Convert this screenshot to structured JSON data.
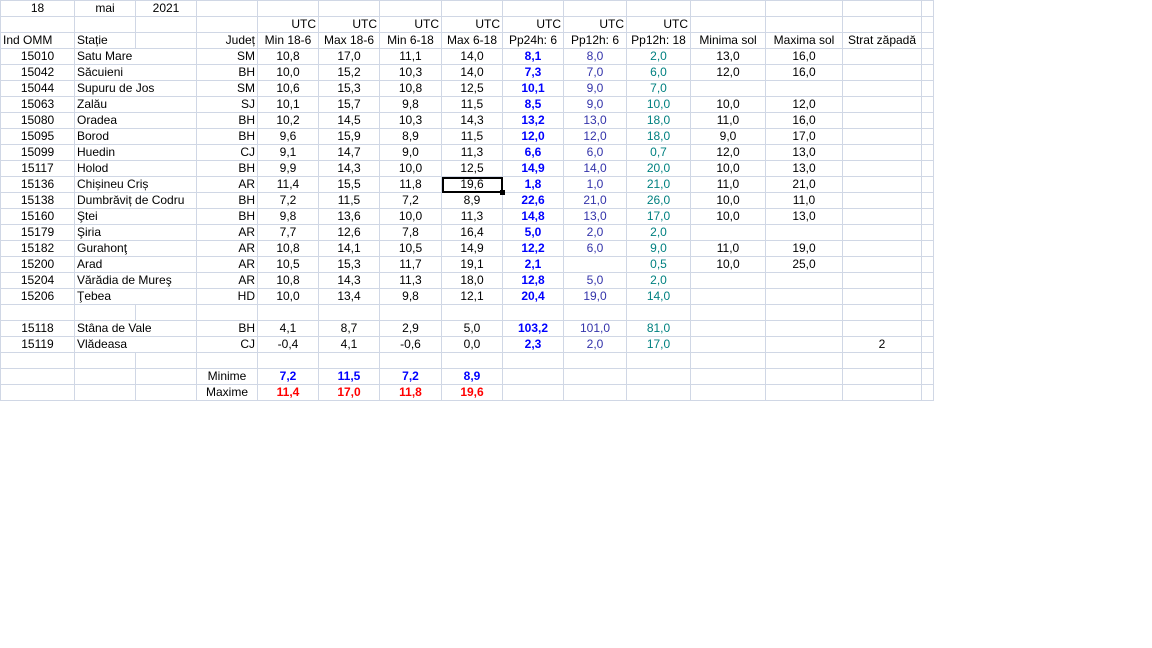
{
  "header": {
    "day": "18",
    "month": "mai",
    "year": "2021"
  },
  "utc_label": "UTC",
  "columns": [
    "Ind OMM",
    "Stație",
    "",
    "Județ",
    "Min 18-6",
    "Max 18-6",
    "Min 6-18",
    "Max 6-18",
    "Pp24h: 6",
    "Pp12h: 6",
    "Pp12h: 18",
    "Minima sol",
    "Maxima sol",
    "Strat zăpadă"
  ],
  "rows": [
    [
      "15010",
      "Satu Mare",
      "SM",
      "10,8",
      "17,0",
      "11,1",
      "14,0",
      "8,1",
      "8,0",
      "2,0",
      "13,0",
      "16,0",
      ""
    ],
    [
      "15042",
      "Săcuieni",
      "BH",
      "10,0",
      "15,2",
      "10,3",
      "14,0",
      "7,3",
      "7,0",
      "6,0",
      "12,0",
      "16,0",
      ""
    ],
    [
      "15044",
      "Supuru de Jos",
      "SM",
      "10,6",
      "15,3",
      "10,8",
      "12,5",
      "10,1",
      "9,0",
      "7,0",
      "",
      "",
      ""
    ],
    [
      "15063",
      "Zalău",
      "SJ",
      "10,1",
      "15,7",
      "9,8",
      "11,5",
      "8,5",
      "9,0",
      "10,0",
      "10,0",
      "12,0",
      ""
    ],
    [
      "15080",
      "Oradea",
      "BH",
      "10,2",
      "14,5",
      "10,3",
      "14,3",
      "13,2",
      "13,0",
      "18,0",
      "11,0",
      "16,0",
      ""
    ],
    [
      "15095",
      "Borod",
      "BH",
      "9,6",
      "15,9",
      "8,9",
      "11,5",
      "12,0",
      "12,0",
      "18,0",
      "9,0",
      "17,0",
      ""
    ],
    [
      "15099",
      "Huedin",
      "CJ",
      "9,1",
      "14,7",
      "9,0",
      "11,3",
      "6,6",
      "6,0",
      "0,7",
      "12,0",
      "13,0",
      ""
    ],
    [
      "15117",
      "Holod",
      "BH",
      "9,9",
      "14,3",
      "10,0",
      "12,5",
      "14,9",
      "14,0",
      "20,0",
      "10,0",
      "13,0",
      ""
    ],
    [
      "15136",
      "Chișineu   Criș",
      "AR",
      "11,4",
      "15,5",
      "11,8",
      "19,6",
      "1,8",
      "1,0",
      "21,0",
      "11,0",
      "21,0",
      ""
    ],
    [
      "15138",
      "Dumbrăviț  de Codru",
      "BH",
      "7,2",
      "11,5",
      "7,2",
      "8,9",
      "22,6",
      "21,0",
      "26,0",
      "10,0",
      "11,0",
      ""
    ],
    [
      "15160",
      "Ştei",
      "BH",
      "9,8",
      "13,6",
      "10,0",
      "11,3",
      "14,8",
      "13,0",
      "17,0",
      "10,0",
      "13,0",
      ""
    ],
    [
      "15179",
      "Şiria",
      "AR",
      "7,7",
      "12,6",
      "7,8",
      "16,4",
      "5,0",
      "2,0",
      "2,0",
      "",
      "",
      ""
    ],
    [
      "15182",
      "Gurahonţ",
      "AR",
      "10,8",
      "14,1",
      "10,5",
      "14,9",
      "12,2",
      "6,0",
      "9,0",
      "11,0",
      "19,0",
      ""
    ],
    [
      "15200",
      "Arad",
      "AR",
      "10,5",
      "15,3",
      "11,7",
      "19,1",
      "2,1",
      "",
      "0,5",
      "10,0",
      "25,0",
      ""
    ],
    [
      "15204",
      "Vărădia de Mureş",
      "AR",
      "10,8",
      "14,3",
      "11,3",
      "18,0",
      "12,8",
      "5,0",
      "2,0",
      "",
      "",
      ""
    ],
    [
      "15206",
      "Ţebea",
      "HD",
      "10,0",
      "13,4",
      "9,8",
      "12,1",
      "20,4",
      "19,0",
      "14,0",
      "",
      "",
      ""
    ]
  ],
  "mountain_rows": [
    [
      "15118",
      "Stâna de Vale",
      "BH",
      "4,1",
      "8,7",
      "2,9",
      "5,0",
      "103,2",
      "101,0",
      "81,0",
      "",
      "",
      ""
    ],
    [
      "15119",
      "Vlădeasa",
      "CJ",
      "-0,4",
      "4,1",
      "-0,6",
      "0,0",
      "2,3",
      "2,0",
      "17,0",
      "",
      "",
      "2"
    ]
  ],
  "summary": {
    "min_label": "Minime",
    "min_values": [
      "7,2",
      "11,5",
      "7,2",
      "8,9"
    ],
    "max_label": "Maxime",
    "max_values": [
      "11,4",
      "17,0",
      "11,8",
      "19,6"
    ]
  },
  "colors": {
    "grid": "#d0d7e5",
    "blue": "#0000ff",
    "navy": "#3333aa",
    "teal": "#008080",
    "red": "#ff0000"
  }
}
